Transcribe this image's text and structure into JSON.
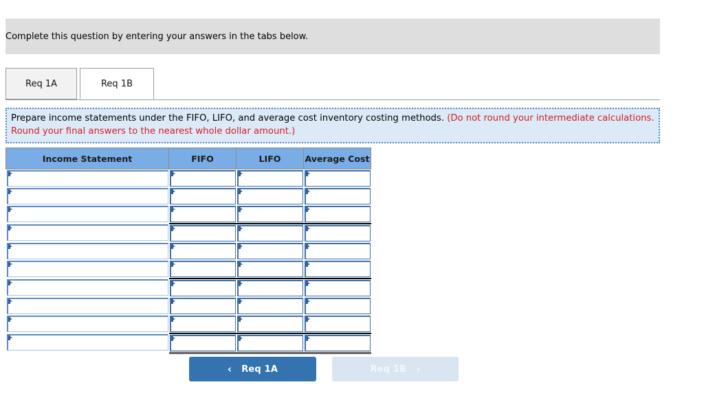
{
  "banner": {
    "text": "Complete this question by entering your answers in the tabs below."
  },
  "tabs": [
    {
      "label": "Req 1A",
      "active": false
    },
    {
      "label": "Req 1B",
      "active": true
    }
  ],
  "instruction": {
    "main": "Prepare income statements under the FIFO, LIFO, and average cost inventory costing methods. ",
    "note": "(Do not round your intermediate calculations. Round your final answers to the nearest whole dollar amount.)",
    "note_color": "#d01f1f"
  },
  "table": {
    "headers": [
      "Income Statement",
      "FIFO",
      "LIFO",
      "Average Cost"
    ],
    "row_count": 10,
    "rows": [
      {
        "label": "",
        "fifo": "",
        "lifo": "",
        "average_cost": ""
      },
      {
        "label": "",
        "fifo": "",
        "lifo": "",
        "average_cost": ""
      },
      {
        "label": "",
        "fifo": "",
        "lifo": "",
        "average_cost": ""
      },
      {
        "label": "",
        "fifo": "",
        "lifo": "",
        "average_cost": ""
      },
      {
        "label": "",
        "fifo": "",
        "lifo": "",
        "average_cost": ""
      },
      {
        "label": "",
        "fifo": "",
        "lifo": "",
        "average_cost": ""
      },
      {
        "label": "",
        "fifo": "",
        "lifo": "",
        "average_cost": ""
      },
      {
        "label": "",
        "fifo": "",
        "lifo": "",
        "average_cost": ""
      },
      {
        "label": "",
        "fifo": "",
        "lifo": "",
        "average_cost": ""
      },
      {
        "label": "",
        "fifo": "",
        "lifo": "",
        "average_cost": ""
      }
    ],
    "subtotal_rule_rows": [
      4,
      7,
      10
    ],
    "total_rule_row": 10,
    "header_color": "#7aace5"
  },
  "nav": {
    "prev_label": "Req 1A",
    "prev_icon": "chevron-left-icon",
    "prev_color": "#3473b0",
    "next_label": "Req 1B",
    "next_icon": "chevron-right-icon",
    "next_color": "#dae5f2",
    "next_disabled": true
  }
}
